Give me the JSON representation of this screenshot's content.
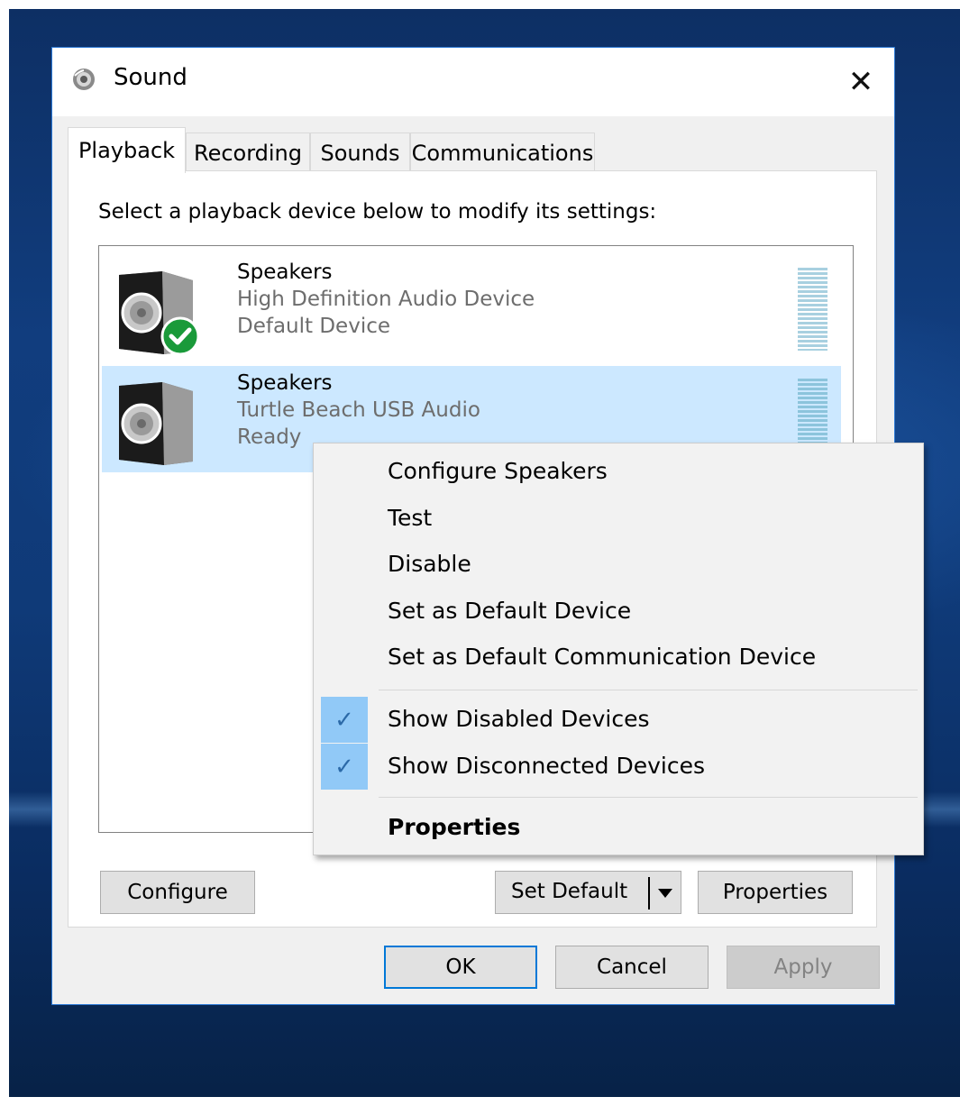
{
  "window": {
    "title": "Sound"
  },
  "tabs": [
    {
      "label": "Playback",
      "active": true
    },
    {
      "label": "Recording",
      "active": false
    },
    {
      "label": "Sounds",
      "active": false
    },
    {
      "label": "Communications",
      "active": false
    }
  ],
  "playback": {
    "instruction": "Select a playback device below to modify its settings:",
    "devices": [
      {
        "name": "Speakers",
        "description": "High Definition Audio Device",
        "status": "Default Device",
        "is_default": true,
        "selected": false
      },
      {
        "name": "Speakers",
        "description": "Turtle Beach USB Audio",
        "status": "Ready",
        "is_default": false,
        "selected": true
      }
    ],
    "buttons": {
      "configure": "Configure",
      "set_default": "Set Default",
      "properties": "Properties"
    }
  },
  "dialog_buttons": {
    "ok": "OK",
    "cancel": "Cancel",
    "apply": "Apply"
  },
  "context_menu": {
    "items": [
      "Configure Speakers",
      "Test",
      "Disable",
      "Set as Default Device",
      "Set as Default Communication Device"
    ],
    "checked_items": [
      {
        "label": "Show Disabled Devices",
        "checked": true
      },
      {
        "label": "Show Disconnected Devices",
        "checked": true
      }
    ],
    "default_item": "Properties"
  },
  "icons": {
    "title": "speaker-icon",
    "close": "close-icon",
    "device": "speaker-device-icon",
    "default_badge": "green-check-icon",
    "checkmark": "checkmark-icon",
    "dropdown": "dropdown-arrow-icon"
  },
  "colors": {
    "selection": "#cce8ff",
    "menu_check": "#91c9f7",
    "accent": "#0078d7",
    "default_badge": "#1a9a3a"
  }
}
